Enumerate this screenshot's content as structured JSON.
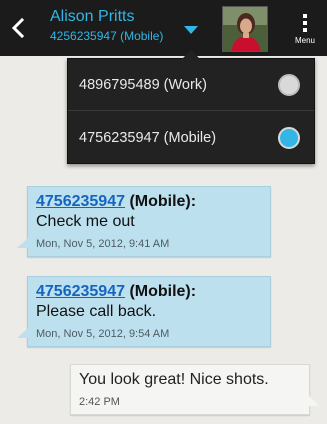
{
  "header": {
    "contact_name": "Alison Pritts",
    "selected_number": "4256235947 (Mobile)",
    "menu_label": "Menu"
  },
  "number_dropdown": {
    "options": [
      {
        "label": "4896795489 (Work)",
        "selected": false
      },
      {
        "label": "4756235947 (Mobile)",
        "selected": true
      }
    ]
  },
  "messages": [
    {
      "direction": "incoming",
      "sender_number": "4756235947",
      "sender_type": "(Mobile):",
      "text": "Check me out",
      "time": "Mon, Nov 5, 2012, 9:41 AM"
    },
    {
      "direction": "incoming",
      "sender_number": "4756235947",
      "sender_type": "(Mobile):",
      "text": "Please call back.",
      "time": "Mon, Nov 5, 2012, 9:54 AM"
    },
    {
      "direction": "outgoing",
      "text": "You look great! Nice shots.",
      "time": "2:42 PM"
    }
  ],
  "colors": {
    "accent": "#33b5e5",
    "incoming_bubble": "#bde0ee",
    "outgoing_bubble": "#f5f5f3",
    "link": "#1565c0",
    "header_bg": "#1b1b1b"
  },
  "icons": [
    "back-arrow-icon",
    "dropdown-arrow-icon",
    "menu-dots-icon"
  ]
}
